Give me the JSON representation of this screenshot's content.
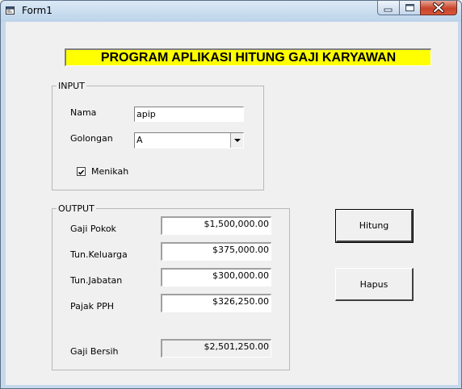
{
  "window": {
    "title": "Form1"
  },
  "banner": {
    "text": "PROGRAM APLIKASI HITUNG GAJI KARYAWAN"
  },
  "input_group": {
    "legend": "INPUT",
    "nama_label": "Nama",
    "nama_value": "apip",
    "golongan_label": "Golongan",
    "golongan_value": "A",
    "menikah_label": "Menikah",
    "menikah_checked": true
  },
  "output_group": {
    "legend": "OUTPUT",
    "gaji_pokok_label": "Gaji Pokok",
    "gaji_pokok_value": "$1,500,000.00",
    "tun_keluarga_label": "Tun.Keluarga",
    "tun_keluarga_value": "$375,000.00",
    "tun_jabatan_label": "Tun.Jabatan",
    "tun_jabatan_value": "$300,000.00",
    "pajak_label": "Pajak PPH",
    "pajak_value": "$326,250.00",
    "gaji_bersih_label": "Gaji Bersih",
    "gaji_bersih_value": "$2,501,250.00"
  },
  "buttons": {
    "hitung": "Hitung",
    "hapus": "Hapus"
  },
  "icons": {
    "app": "form-icon",
    "minimize": "minimize-icon",
    "maximize": "maximize-icon",
    "close": "close-icon",
    "combo": "chevron-down-icon",
    "check": "check-icon"
  }
}
